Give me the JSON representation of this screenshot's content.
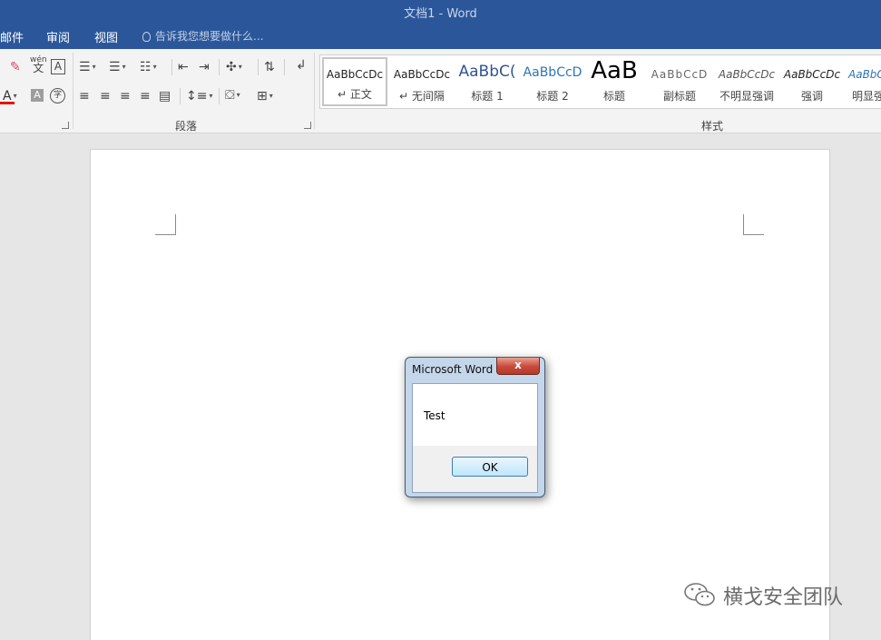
{
  "window": {
    "title": "文档1 - Word"
  },
  "tabs": [
    {
      "label": "邮件"
    },
    {
      "label": "审阅"
    },
    {
      "label": "视图"
    }
  ],
  "tell_me": {
    "placeholder": "告诉我您想要做什么..."
  },
  "ribbon": {
    "groups": [
      {
        "label": "段落"
      },
      {
        "label": "样式"
      }
    ],
    "font_icons": {
      "wen": "wén",
      "wen_char": "文",
      "char_border": "A",
      "font_color": "A",
      "highlight": "A",
      "enclose": "字"
    },
    "styles": [
      {
        "preview": "AaBbCcDc",
        "name": "正文",
        "selected": true
      },
      {
        "preview": "AaBbCcDc",
        "name": "无间隔"
      },
      {
        "preview": "AaBbC(",
        "name": "标题 1"
      },
      {
        "preview": "AaBbCcD",
        "name": "标题 2"
      },
      {
        "preview": "AaB",
        "name": "标题"
      },
      {
        "preview": "AaBbCcD",
        "name": "副标题"
      },
      {
        "preview": "AaBbCcDc",
        "name": "不明显强调"
      },
      {
        "preview": "AaBbCcDc",
        "name": "强调"
      },
      {
        "preview": "AaBbC",
        "name": "明显强"
      }
    ]
  },
  "dialog": {
    "title": "Microsoft Word",
    "close": "x",
    "message": "Test",
    "ok_label": "OK"
  },
  "watermark": {
    "text": "横戈安全团队"
  },
  "colors": {
    "titlebar": "#2b579a",
    "font_color_underline": "#e51400"
  }
}
